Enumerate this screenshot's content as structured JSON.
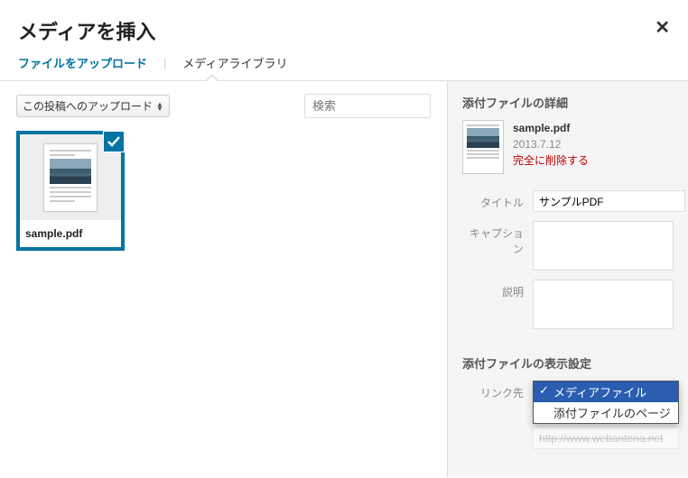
{
  "header": {
    "title": "メディアを挿入"
  },
  "tabs": {
    "upload": "ファイルをアップロード",
    "library": "メディアライブラリ"
  },
  "library": {
    "filter_label": "この投稿へのアップロード",
    "search_placeholder": "検索",
    "thumb": {
      "name": "sample.pdf"
    }
  },
  "sidebar": {
    "details_title": "添付ファイルの詳細",
    "file": {
      "name": "sample.pdf",
      "date": "2013.7.12",
      "delete_label": "完全に削除する"
    },
    "fields": {
      "title_label": "タイトル",
      "title_value": "サンプルPDF",
      "caption_label": "キャプション",
      "caption_value": "",
      "description_label": "説明",
      "description_value": ""
    },
    "display": {
      "section_title": "添付ファイルの表示設定",
      "linkto_label": "リンク先",
      "options": {
        "media_file": "メディアファイル",
        "attachment_page": "添付ファイルのページ"
      },
      "url": "http://www.webantena.net"
    }
  }
}
